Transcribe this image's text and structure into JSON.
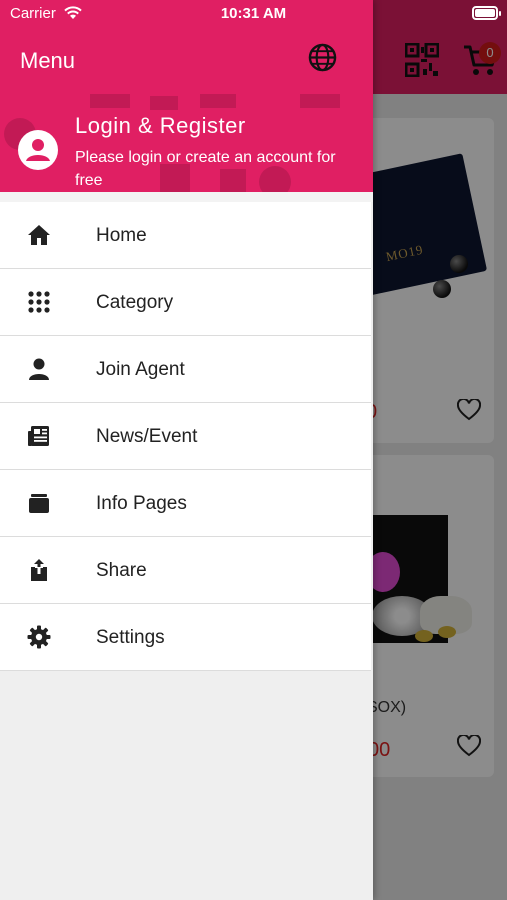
{
  "status_bar": {
    "carrier": "Carrier",
    "time": "10:31 AM"
  },
  "background_app": {
    "cart_badge": "0",
    "products": [
      {
        "logo_text": "MO19",
        "price_fragment": "0"
      },
      {
        "name_fragment": "SOX)",
        "price_fragment": "00"
      }
    ]
  },
  "drawer": {
    "title": "Menu",
    "login": {
      "title": "Login & Register",
      "subtitle": "Please login or create an account for free"
    },
    "items": [
      {
        "label": "Home",
        "icon": "home-icon"
      },
      {
        "label": "Category",
        "icon": "grid-icon"
      },
      {
        "label": "Join Agent",
        "icon": "person-icon"
      },
      {
        "label": "News/Event",
        "icon": "newspaper-icon"
      },
      {
        "label": "Info Pages",
        "icon": "archive-icon"
      },
      {
        "label": "Share",
        "icon": "share-icon"
      },
      {
        "label": "Settings",
        "icon": "gear-icon"
      }
    ]
  },
  "colors": {
    "brand": "#e01f63",
    "badge": "#d31b1b",
    "price": "#e02424"
  }
}
